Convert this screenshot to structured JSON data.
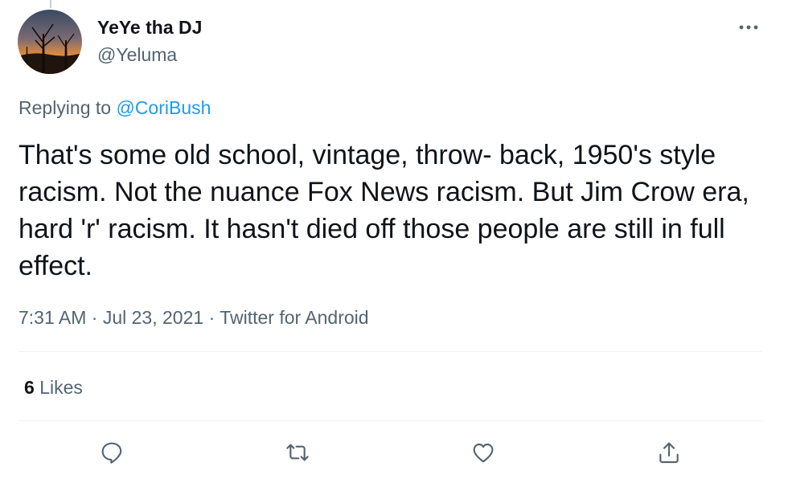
{
  "tweet": {
    "author_name": "YeYe tha DJ",
    "author_handle": "@Yeluma",
    "replying_to_prefix": "Replying to",
    "replying_to_handle": "@CoriBush",
    "text": "That's some old school, vintage, throw- back, 1950's style racism. Not the nuance Fox News racism. But Jim Crow era, hard 'r' racism. It hasn't died off those people are still in full effect.",
    "time": "7:31 AM",
    "separator": "·",
    "date": "Jul 23, 2021",
    "source": "Twitter for Android",
    "likes_count": "6",
    "likes_label": "Likes"
  },
  "icons": {
    "more": "more-icon",
    "reply": "reply-icon",
    "retweet": "retweet-icon",
    "like": "like-icon",
    "share": "share-icon"
  },
  "colors": {
    "text_primary": "#0f1419",
    "text_secondary": "#536471",
    "link": "#1d9bf0",
    "divider": "#eff3f4"
  }
}
